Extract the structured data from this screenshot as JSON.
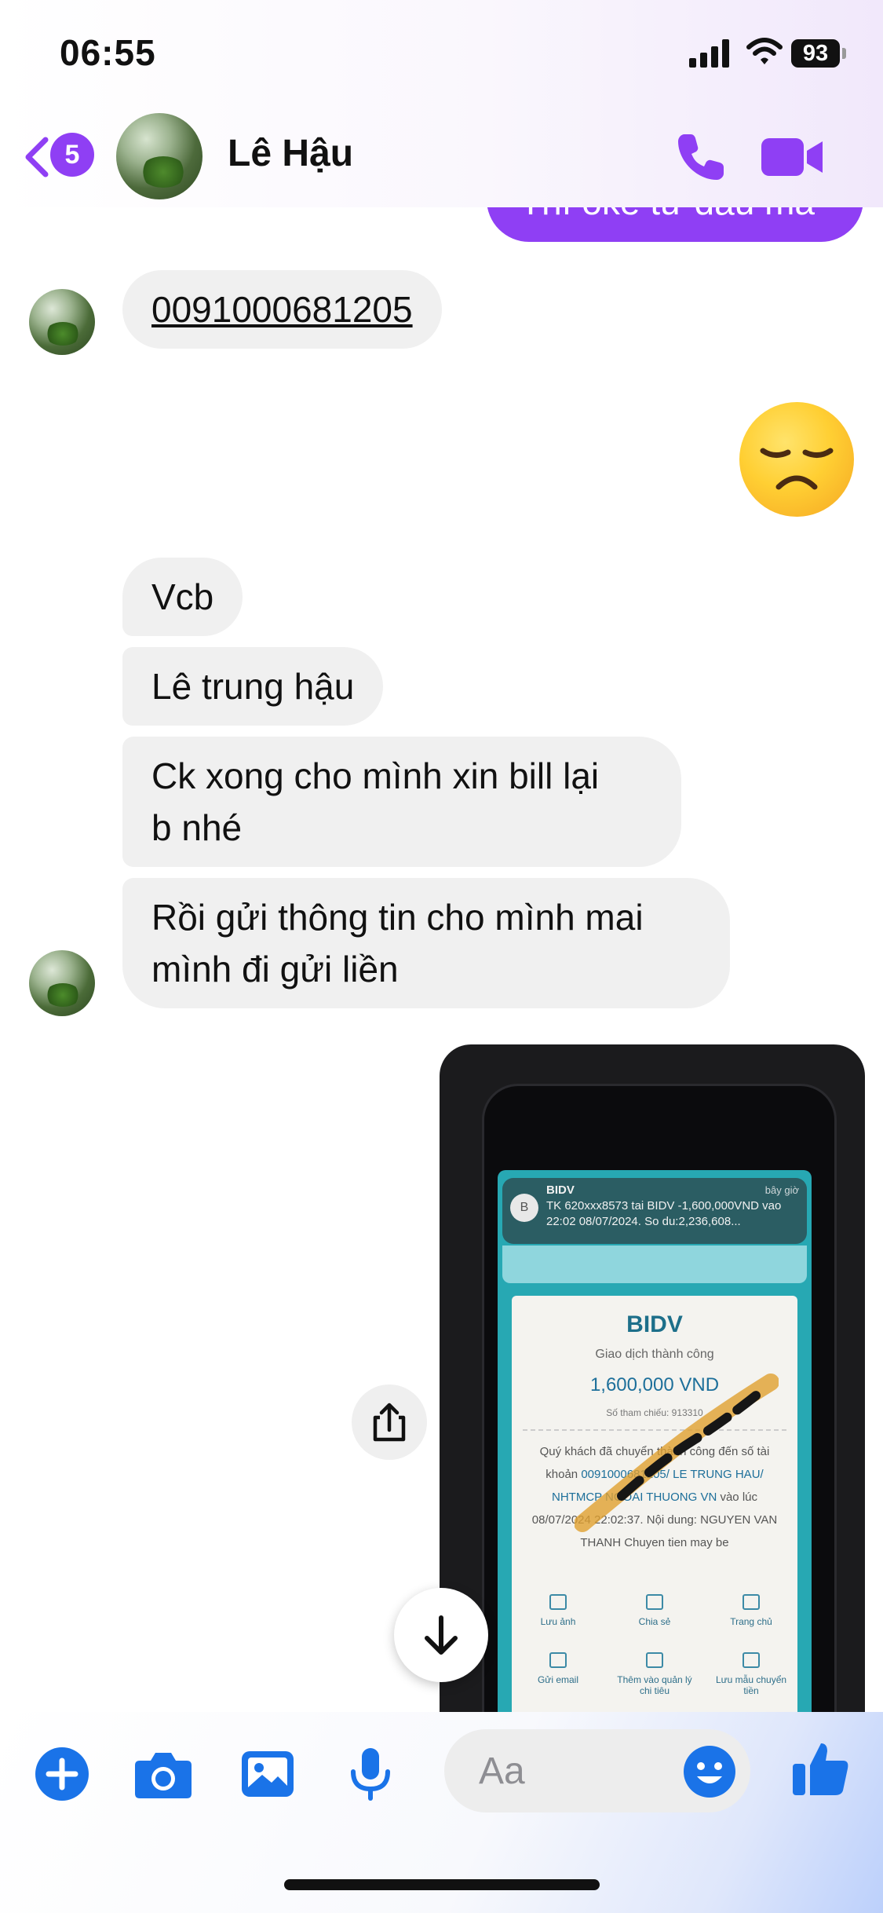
{
  "status_bar": {
    "time": "06:55",
    "battery": "93"
  },
  "header": {
    "back_badge": "5",
    "contact_name": "Lê Hậu"
  },
  "messages": {
    "outgoing_partial_text": "Thì oke từ đầu mà",
    "account_number": "0091000681205",
    "emoji": "😞",
    "bubbles": [
      {
        "lines": [
          "Vcb"
        ]
      },
      {
        "lines": [
          "Lê trung hậu"
        ]
      },
      {
        "lines": [
          "Ck xong cho mình xin bill lại",
          "b nhé"
        ]
      },
      {
        "lines": [
          "Rồi gửi thông tin cho mình mai",
          "mình đi gửi liền"
        ]
      }
    ]
  },
  "photo_receipt": {
    "notification_icon": "B",
    "notification_title": "BIDV",
    "notification_time": "bây giờ",
    "notification_body": "TK 620xxx8573 tai BIDV -1,600,000VND vao 22:02 08/07/2024. So du:2,236,608...",
    "brand": "BIDV",
    "status": "Giao dịch thành công",
    "amount": "1,600,000 VND",
    "reference": "Số tham chiếu: 913310",
    "detail_prefix": "Quý khách đã chuyển thành công đến số tài khoản ",
    "detail_account": "0091000681205/ LE TRUNG HAU/ NHTMCP NGOAI THUONG VN",
    "detail_suffix": " vào lúc 08/07/2024 22:02:37. Nội dung: NGUYEN VAN THANH Chuyen tien may be",
    "actions": [
      "Lưu ảnh",
      "Chia sẻ",
      "Trang chủ",
      "Gửi email",
      "Thêm vào quản lý chi tiêu",
      "Lưu mẫu chuyển tiền"
    ]
  },
  "composer": {
    "placeholder": "Aa"
  },
  "colors": {
    "accent": "#8f3ff4",
    "icon_blue": "#1a73e8",
    "bubble_gray": "#f0f0f0"
  },
  "icons": [
    "chevron-left-icon",
    "phone-icon",
    "video-camera-icon",
    "share-icon",
    "arrow-down-icon",
    "plus-icon",
    "camera-icon",
    "image-icon",
    "microphone-icon",
    "smiley-icon",
    "thumbs-up-icon"
  ]
}
